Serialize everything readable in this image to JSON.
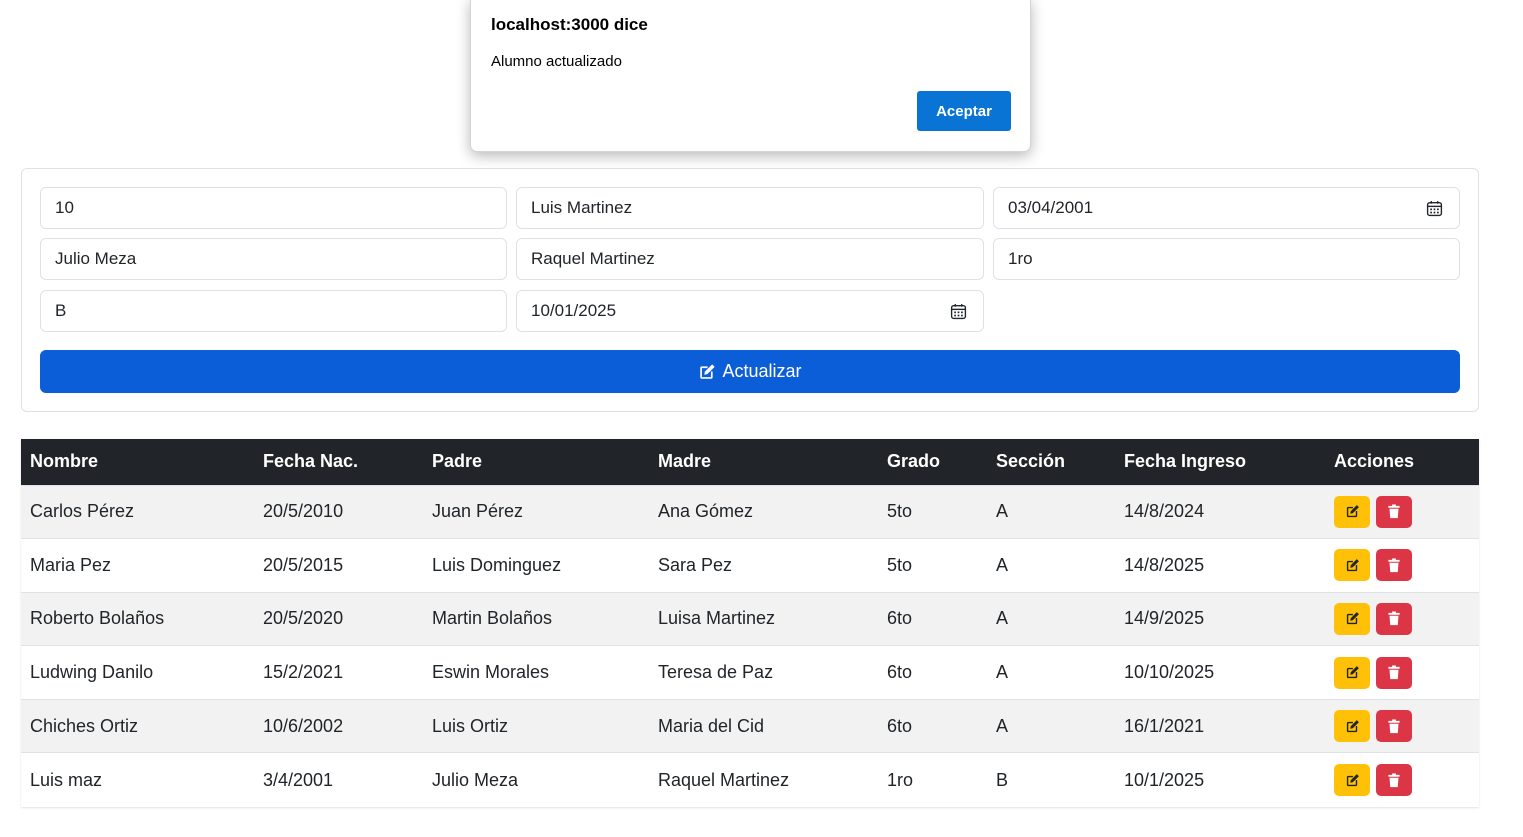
{
  "dialog": {
    "title": "localhost:3000 dice",
    "message": "Alumno actualizado",
    "button_label": "Aceptar"
  },
  "form": {
    "fields": [
      {
        "value": "10",
        "type": "text"
      },
      {
        "value": "Luis Martinez",
        "type": "text"
      },
      {
        "value": "03/04/2001",
        "type": "date"
      },
      {
        "value": "Julio Meza",
        "type": "text"
      },
      {
        "value": "Raquel Martinez",
        "type": "text"
      },
      {
        "value": "1ro",
        "type": "text"
      },
      {
        "value": "B",
        "type": "text"
      },
      {
        "value": "10/01/2025",
        "type": "date"
      }
    ],
    "submit_label": "Actualizar",
    "submit_icon": "pen-to-square-icon"
  },
  "table": {
    "headers": [
      "Nombre",
      "Fecha Nac.",
      "Padre",
      "Madre",
      "Grado",
      "Sección",
      "Fecha Ingreso",
      "Acciones"
    ],
    "rows": [
      [
        "Carlos Pérez",
        "20/5/2010",
        "Juan Pérez",
        "Ana Gómez",
        "5to",
        "A",
        "14/8/2024"
      ],
      [
        "Maria Pez",
        "20/5/2015",
        "Luis Dominguez",
        "Sara Pez",
        "5to",
        "A",
        "14/8/2025"
      ],
      [
        "Roberto Bolaños",
        "20/5/2020",
        "Martin Bolaños",
        "Luisa Martinez",
        "6to",
        "A",
        "14/9/2025"
      ],
      [
        "Ludwing Danilo",
        "15/2/2021",
        "Eswin Morales",
        "Teresa de Paz",
        "6to",
        "A",
        "10/10/2025"
      ],
      [
        "Chiches Ortiz",
        "10/6/2002",
        "Luis Ortiz",
        "Maria del Cid",
        "6to",
        "A",
        "16/1/2021"
      ],
      [
        "Luis maz",
        "3/4/2001",
        "Julio Meza",
        "Raquel Martinez",
        "1ro",
        "B",
        "10/1/2025"
      ]
    ],
    "row_actions": {
      "edit_icon": "edit-icon",
      "delete_icon": "trash-icon"
    }
  },
  "colors": {
    "primary": "#0b5ed7",
    "warning": "#ffc107",
    "danger": "#dc3545",
    "table_header": "#212529",
    "dialog_button": "#0a74d4"
  }
}
